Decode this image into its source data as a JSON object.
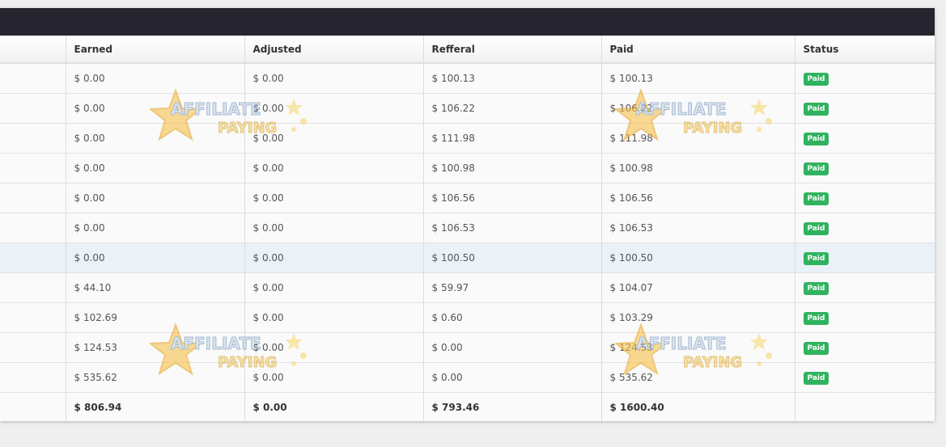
{
  "table": {
    "headers": [
      "",
      "Earned",
      "Adjusted",
      "Refferal",
      "Paid",
      "Status"
    ],
    "rows": [
      {
        "earned": "$ 0.00",
        "adjusted": "$ 0.00",
        "referral": "$ 100.13",
        "paid": "$ 100.13",
        "status": "Paid"
      },
      {
        "earned": "$ 0.00",
        "adjusted": "$ 0.00",
        "referral": "$ 106.22",
        "paid": "$ 106.22",
        "status": "Paid"
      },
      {
        "earned": "$ 0.00",
        "adjusted": "$ 0.00",
        "referral": "$ 111.98",
        "paid": "$ 111.98",
        "status": "Paid"
      },
      {
        "earned": "$ 0.00",
        "adjusted": "$ 0.00",
        "referral": "$ 100.98",
        "paid": "$ 100.98",
        "status": "Paid"
      },
      {
        "earned": "$ 0.00",
        "adjusted": "$ 0.00",
        "referral": "$ 106.56",
        "paid": "$ 106.56",
        "status": "Paid"
      },
      {
        "earned": "$ 0.00",
        "adjusted": "$ 0.00",
        "referral": "$ 106.53",
        "paid": "$ 106.53",
        "status": "Paid"
      },
      {
        "earned": "$ 0.00",
        "adjusted": "$ 0.00",
        "referral": "$ 100.50",
        "paid": "$ 100.50",
        "status": "Paid"
      },
      {
        "earned": "$ 44.10",
        "adjusted": "$ 0.00",
        "referral": "$ 59.97",
        "paid": "$ 104.07",
        "status": "Paid"
      },
      {
        "earned": "$ 102.69",
        "adjusted": "$ 0.00",
        "referral": "$ 0.60",
        "paid": "$ 103.29",
        "status": "Paid"
      },
      {
        "earned": "$ 124.53",
        "adjusted": "$ 0.00",
        "referral": "$ 0.00",
        "paid": "$ 124.53",
        "status": "Paid"
      },
      {
        "earned": "$ 535.62",
        "adjusted": "$ 0.00",
        "referral": "$ 0.00",
        "paid": "$ 535.62",
        "status": "Paid"
      }
    ],
    "totals": {
      "earned": "$ 806.94",
      "adjusted": "$ 0.00",
      "referral": "$ 793.46",
      "paid": "$ 1600.40"
    }
  },
  "watermark": {
    "line1": "AFFILIATE",
    "line2": "PAYING"
  },
  "colors": {
    "header_bar": "#26252f",
    "badge": "#2fb35e",
    "highlight_row": "#eaf1f7"
  }
}
